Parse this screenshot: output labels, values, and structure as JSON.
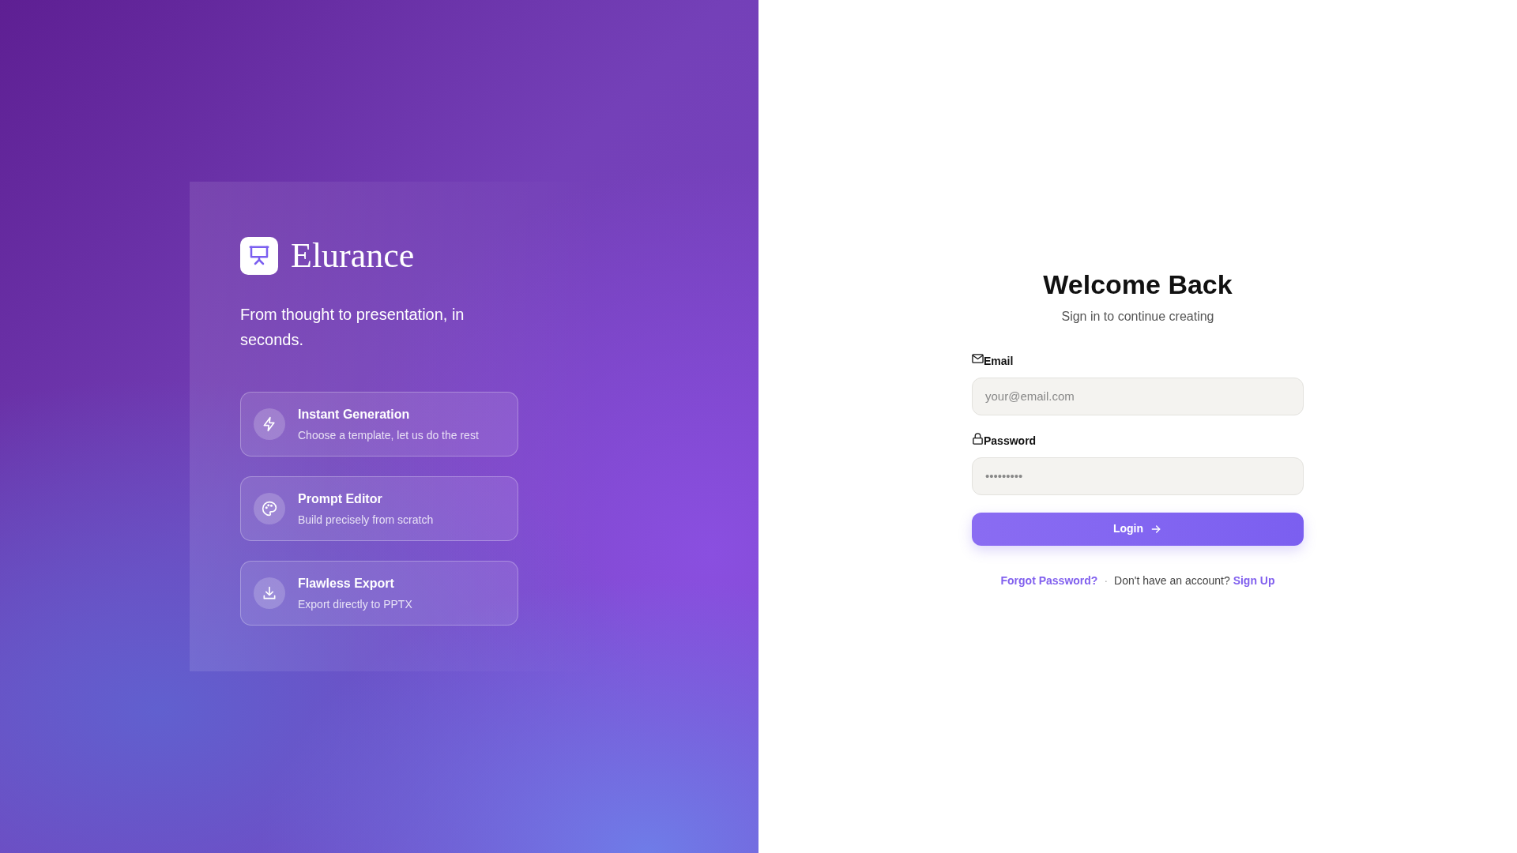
{
  "brand": {
    "name": "Elurance",
    "tagline": "From thought to presentation, in seconds."
  },
  "features": [
    {
      "kind": "bolt",
      "title": "Instant Generation",
      "subtitle": "Choose a template, let us do the rest"
    },
    {
      "kind": "palette",
      "title": "Prompt Editor",
      "subtitle": "Build precisely from scratch"
    },
    {
      "kind": "download",
      "title": "Flawless Export",
      "subtitle": "Export directly to PPTX"
    }
  ],
  "login": {
    "title": "Welcome Back",
    "subtitle": "Sign in to continue creating",
    "fields": [
      {
        "kind": "email",
        "label": "Email",
        "placeholder": "your@email.com"
      },
      {
        "kind": "password",
        "label": "Password",
        "placeholder": "•••••••••"
      }
    ],
    "button": "Login",
    "forgot": "Forgot Password?",
    "separator": "·",
    "prompt": "Don't have an account?",
    "signup": "Sign Up"
  }
}
